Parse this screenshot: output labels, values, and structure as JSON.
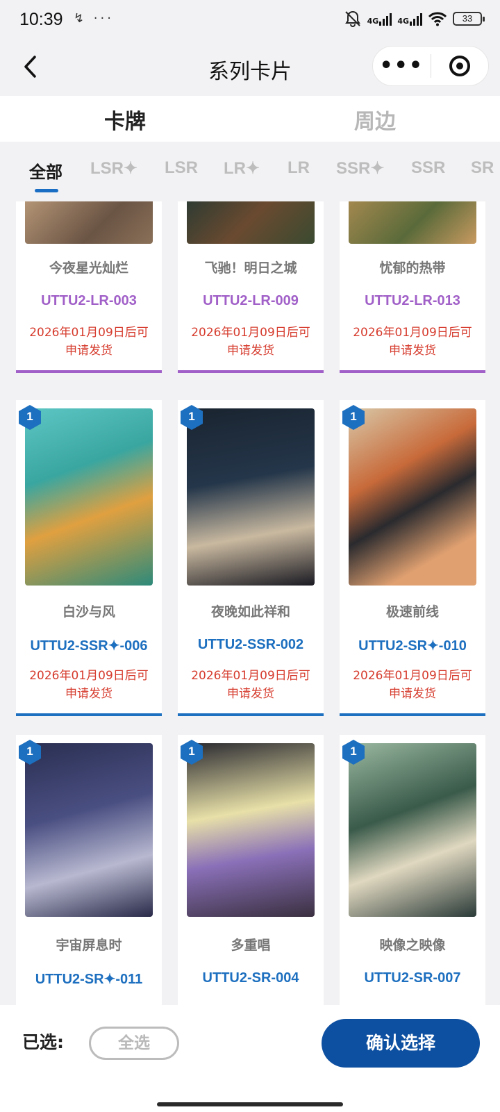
{
  "status_bar": {
    "time": "10:39",
    "left_icons": "↯ ···",
    "battery": "33",
    "network": "4G"
  },
  "nav": {
    "title": "系列卡片",
    "more": "•••"
  },
  "main_tabs": [
    {
      "label": "卡牌",
      "active": true
    },
    {
      "label": "周边",
      "active": false
    }
  ],
  "filter_tabs": [
    {
      "label": "全部",
      "active": true
    },
    {
      "label": "LSR✦",
      "active": false
    },
    {
      "label": "LSR",
      "active": false
    },
    {
      "label": "LR✦",
      "active": false
    },
    {
      "label": "LR",
      "active": false
    },
    {
      "label": "SSR✦",
      "active": false
    },
    {
      "label": "SSR",
      "active": false
    },
    {
      "label": "SR",
      "active": false
    }
  ],
  "cards": [
    {
      "name": "今夜星光灿烂",
      "code": "UTTU2-LR-003",
      "date_line1": "2026年01月09日后可",
      "date_line2": "申请发货",
      "tier": "lr",
      "count": "1"
    },
    {
      "name": "飞驰！明日之城",
      "code": "UTTU2-LR-009",
      "date_line1": "2026年01月09日后可",
      "date_line2": "申请发货",
      "tier": "lr",
      "count": "1"
    },
    {
      "name": "忧郁的热带",
      "code": "UTTU2-LR-013",
      "date_line1": "2026年01月09日后可",
      "date_line2": "申请发货",
      "tier": "lr",
      "count": "1"
    },
    {
      "name": "白沙与风",
      "code": "UTTU2-SSR✦-006",
      "date_line1": "2026年01月09日后可",
      "date_line2": "申请发货",
      "tier": "blue",
      "count": "1"
    },
    {
      "name": "夜晚如此祥和",
      "code": "UTTU2-SSR-002",
      "date_line1": "2026年01月09日后可",
      "date_line2": "申请发货",
      "tier": "blue",
      "count": "1"
    },
    {
      "name": "极速前线",
      "code": "UTTU2-SR✦-010",
      "date_line1": "2026年01月09日后可",
      "date_line2": "申请发货",
      "tier": "blue",
      "count": "1"
    },
    {
      "name": "宇宙屏息时",
      "code": "UTTU2-SR✦-011",
      "date_line1": "",
      "date_line2": "",
      "tier": "blue",
      "count": "1"
    },
    {
      "name": "多重唱",
      "code": "UTTU2-SR-004",
      "date_line1": "",
      "date_line2": "",
      "tier": "blue",
      "count": "1"
    },
    {
      "name": "映像之映像",
      "code": "UTTU2-SR-007",
      "date_line1": "",
      "date_line2": "",
      "tier": "blue",
      "count": "1"
    }
  ],
  "bottom": {
    "selected_label": "已选:",
    "select_all": "全选",
    "confirm": "确认选择"
  },
  "colors": {
    "accent": "#0d4fa0",
    "lr": "#a160c8",
    "blue_tier": "#1d6fbf",
    "date_red": "#d63c2e"
  }
}
